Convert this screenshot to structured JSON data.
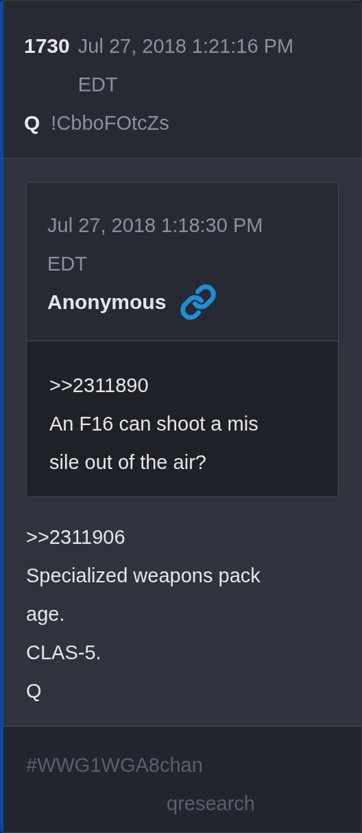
{
  "post": {
    "number": "1730",
    "date": "Jul 27, 2018 1:21:16 PM",
    "timezone": "EDT",
    "author": "Q",
    "tripcode": "!CbboFOtcZs"
  },
  "quote": {
    "date": "Jul 27, 2018 1:18:30 PM",
    "timezone": "EDT",
    "author": "Anonymous",
    "lines": [
      ">>2311890",
      "An F16 can shoot a mis",
      "sile out of the air?"
    ]
  },
  "body_lines": [
    ">>2311906",
    "Specialized weapons pack",
    "age.",
    "CLAS-5.",
    "Q"
  ],
  "footer": {
    "hashtag": "#WWG1WGA8chan",
    "board": "qresearch"
  }
}
